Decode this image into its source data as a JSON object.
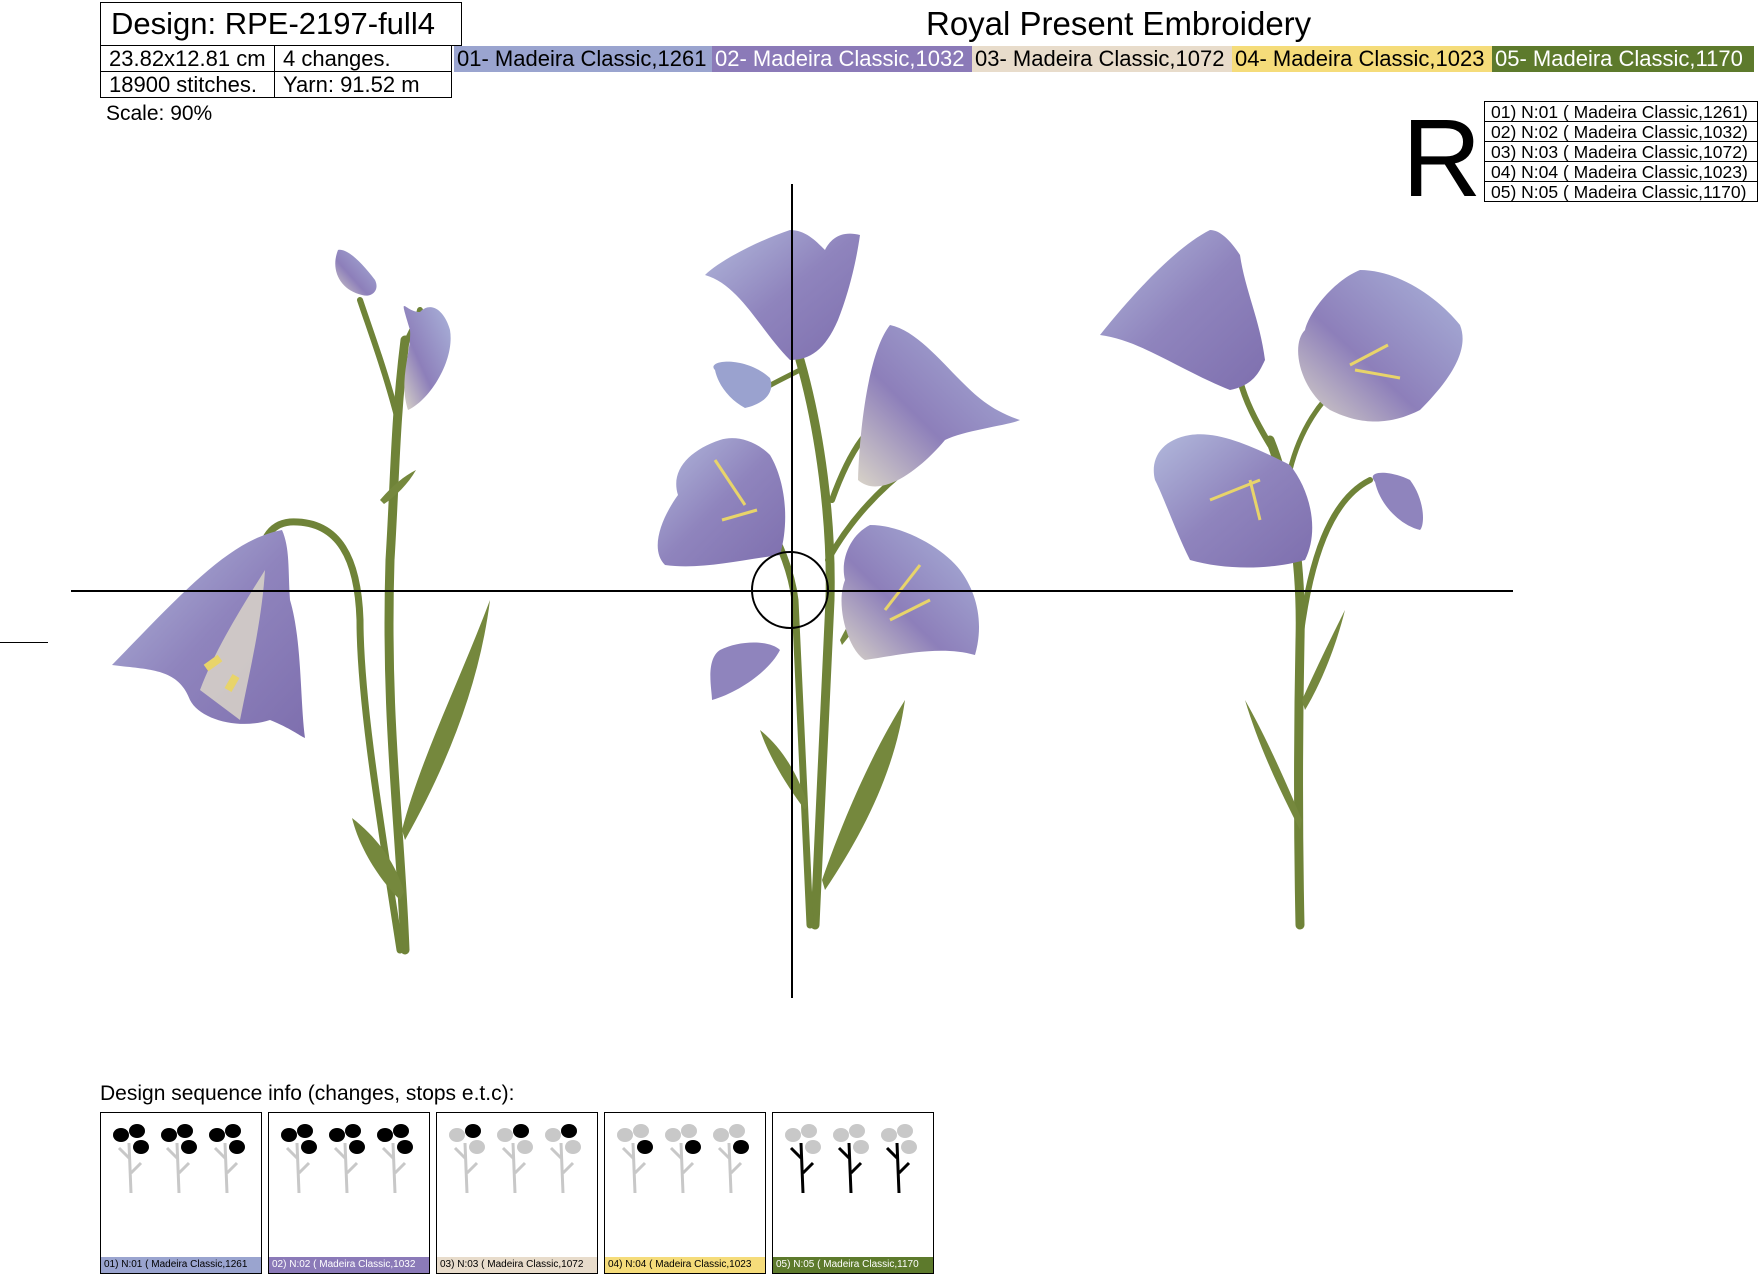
{
  "header": {
    "design_title": "Design: RPE-2197-full4",
    "size": "23.82x12.81 cm",
    "changes": "4 changes.",
    "stitches": "18900 stitches.",
    "yarn": "Yarn: 91.52 m",
    "brand": "Royal Present Embroidery",
    "scale": "Scale: 90%"
  },
  "threads": [
    {
      "label": "01- Madeira Classic,1261",
      "color": "#9aa4cf",
      "text_color": "#000000"
    },
    {
      "label": "02- Madeira Classic,1032",
      "color": "#8b7ab8",
      "text_color": "#ffffff"
    },
    {
      "label": "03- Madeira Classic,1072",
      "color": "#e8dccb",
      "text_color": "#000000"
    },
    {
      "label": "04- Madeira Classic,1023",
      "color": "#f5dc7a",
      "text_color": "#000000"
    },
    {
      "label": "05- Madeira Classic,1170",
      "color": "#5d7a2c",
      "text_color": "#ffffff"
    }
  ],
  "legend": {
    "marker": "R",
    "rows": [
      "01) N:01 ( Madeira Classic,1261)",
      "02) N:02 ( Madeira Classic,1032)",
      "03) N:03 ( Madeira Classic,1072)",
      "04) N:04 ( Madeira Classic,1023)",
      "05) N:05 ( Madeira Classic,1170)"
    ]
  },
  "sequence": {
    "title": "Design sequence info (changes, stops e.t.c):",
    "thumbs": [
      {
        "label": "01) N:01 ( Madeira Classic,1261",
        "color": "#9aa4cf",
        "text_color": "#000000",
        "step": 1
      },
      {
        "label": "02) N:02 ( Madeira Classic,1032",
        "color": "#8b7ab8",
        "text_color": "#ffffff",
        "step": 2
      },
      {
        "label": "03) N:03 ( Madeira Classic,1072",
        "color": "#e8dccb",
        "text_color": "#000000",
        "step": 3
      },
      {
        "label": "04) N:04 ( Madeira Classic,1023",
        "color": "#f5dc7a",
        "text_color": "#000000",
        "step": 4
      },
      {
        "label": "05) N:05 ( Madeira Classic,1170",
        "color": "#5d7a2c",
        "text_color": "#ffffff",
        "step": 5
      }
    ]
  },
  "colors": {
    "stem": "#6f8338",
    "petal_light": "#a9b2d8",
    "petal_dark": "#8a79b4",
    "petal_highlight": "#ddd8cc",
    "pollen": "#e8d46a"
  }
}
